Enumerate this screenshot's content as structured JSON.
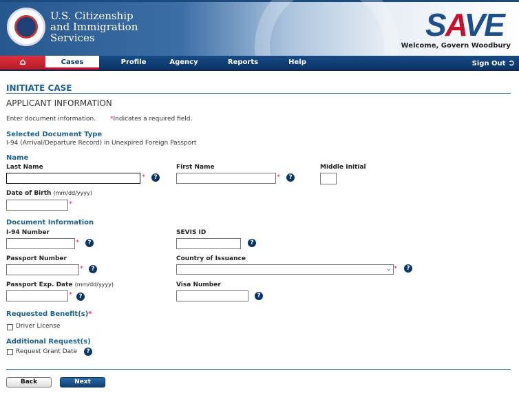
{
  "header": {
    "agency_name": [
      "U.S. Citizenship",
      "and Immigration",
      "Services"
    ],
    "logo": "SAVE",
    "welcome": "Welcome, Govern Woodbury"
  },
  "nav": {
    "home_icon": "home-icon",
    "items": [
      "Cases",
      "Profile",
      "Agency",
      "Reports",
      "Help"
    ],
    "sign_out": "Sign Out",
    "sign_out_icon": "sign-out-icon"
  },
  "page": {
    "title": "INITIATE CASE",
    "subtitle": "APPLICANT INFORMATION",
    "instruction": "Enter document information.",
    "required_note": "Indicates a required field.",
    "star": "*"
  },
  "doc_type": {
    "label": "Selected Document Type",
    "value": "I-94 (Arrival/Departure Record) in Unexpired Foreign Passport"
  },
  "name": {
    "section": "Name",
    "last": "Last Name",
    "first": "First Name",
    "middle": "Middle Initial",
    "dob": "Date of Birth",
    "dob_hint": "(mm/dd/yyyy)"
  },
  "document": {
    "section": "Document Information",
    "i94": "I-94 Number",
    "sevis": "SEVIS ID",
    "passport": "Passport Number",
    "country": "Country of Issuance",
    "country_value": "",
    "exp": "Passport Exp. Date",
    "exp_hint": "(mm/dd/yyyy)",
    "visa": "Visa Number"
  },
  "benefits": {
    "section": "Requested Benefit(s)",
    "driver_license": "Driver License"
  },
  "additional": {
    "section": "Additional Request(s)",
    "grant_date": "Request Grant Date"
  },
  "buttons": {
    "back": "Back",
    "next": "Next"
  },
  "help_glyph": "?",
  "colors": {
    "accent": "#1d6190",
    "nav": "#0c3468",
    "home": "#c8102e"
  }
}
